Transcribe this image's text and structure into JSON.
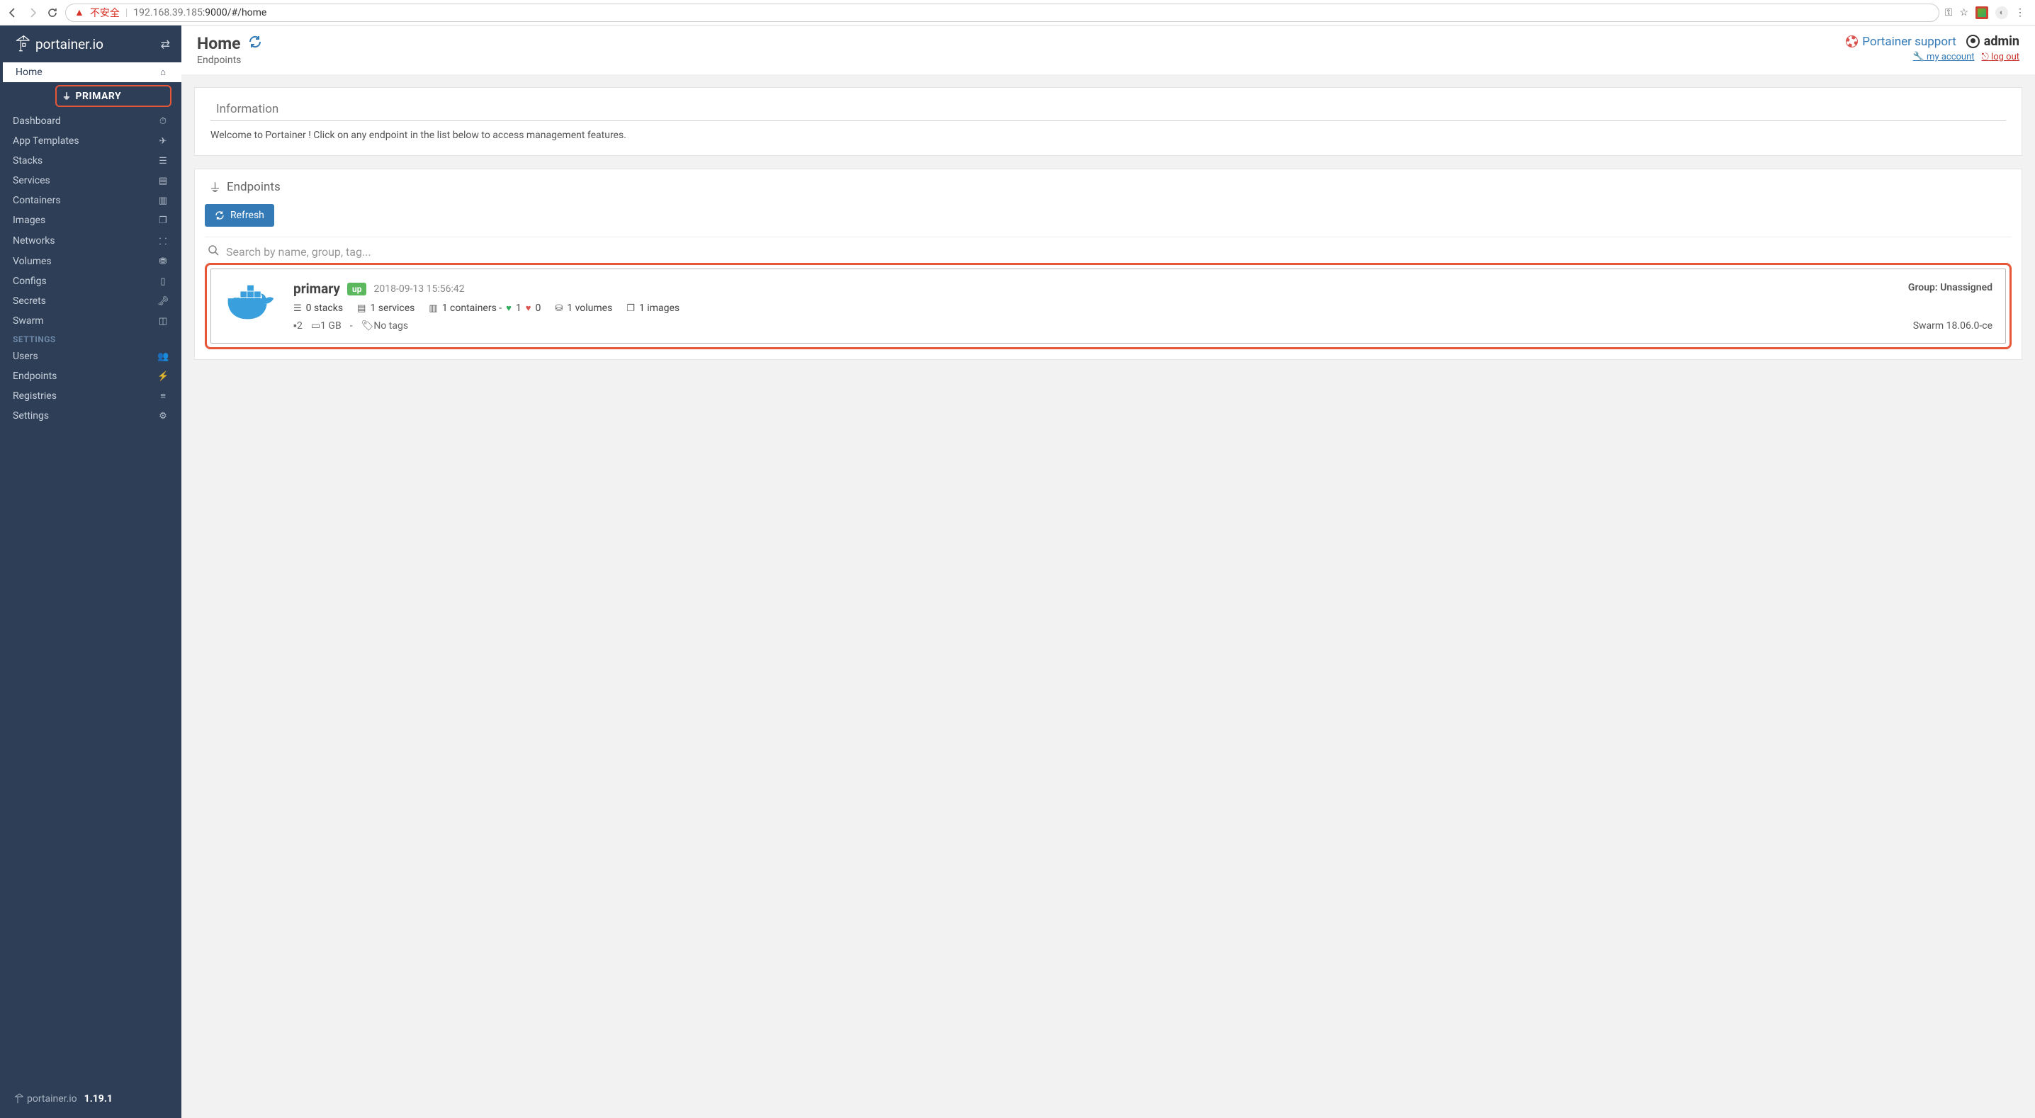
{
  "browser": {
    "warn_label": "不安全",
    "url_host": "192.168.39.185",
    "url_rest": ":9000/#/home"
  },
  "brand": "portainer.io",
  "version": "1.19.1",
  "sidebar": {
    "home": "Home",
    "primary_sub": "PRIMARY",
    "items": [
      {
        "label": "Dashboard",
        "icon": "tachometer"
      },
      {
        "label": "App Templates",
        "icon": "rocket"
      },
      {
        "label": "Stacks",
        "icon": "list"
      },
      {
        "label": "Services",
        "icon": "list-alt"
      },
      {
        "label": "Containers",
        "icon": "server"
      },
      {
        "label": "Images",
        "icon": "clone"
      },
      {
        "label": "Networks",
        "icon": "sitemap"
      },
      {
        "label": "Volumes",
        "icon": "hdd"
      },
      {
        "label": "Configs",
        "icon": "file"
      },
      {
        "label": "Secrets",
        "icon": "lock"
      },
      {
        "label": "Swarm",
        "icon": "object-group"
      }
    ],
    "settings_header": "SETTINGS",
    "settings": [
      {
        "label": "Users",
        "icon": "users"
      },
      {
        "label": "Endpoints",
        "icon": "plug"
      },
      {
        "label": "Registries",
        "icon": "database"
      },
      {
        "label": "Settings",
        "icon": "cogs"
      }
    ]
  },
  "header": {
    "title": "Home",
    "subtitle": "Endpoints",
    "support": "Portainer support",
    "username": "admin",
    "account": "my account",
    "logout": "log out"
  },
  "info": {
    "title": "Information",
    "text": "Welcome to Portainer ! Click on any endpoint in the list below to access management features."
  },
  "endpoints": {
    "title": "Endpoints",
    "refresh": "Refresh",
    "search_placeholder": "Search by name, group, tag...",
    "card": {
      "name": "primary",
      "status": "up",
      "timestamp": "2018-09-13 15:56:42",
      "stacks": "0 stacks",
      "services": "1 services",
      "containers_prefix": "1 containers -",
      "healthy": "1",
      "unhealthy": "0",
      "volumes": "1 volumes",
      "images": "1 images",
      "cpu": "2",
      "mem": "1 GB",
      "separator": "-",
      "no_tags": "No tags",
      "group_label": "Group: ",
      "group_value": "Unassigned",
      "engine": "Swarm 18.06.0-ce"
    }
  },
  "icons": {
    "tachometer": "⏱",
    "rocket": "✈",
    "list": "☰",
    "list-alt": "▤",
    "server": "▥",
    "clone": "❐",
    "sitemap": "⸬",
    "hdd": "⛃",
    "file": "▯",
    "lock": "🗝",
    "object-group": "◫",
    "users": "👥",
    "plug": "⚡",
    "database": "≡",
    "cogs": "⚙"
  }
}
